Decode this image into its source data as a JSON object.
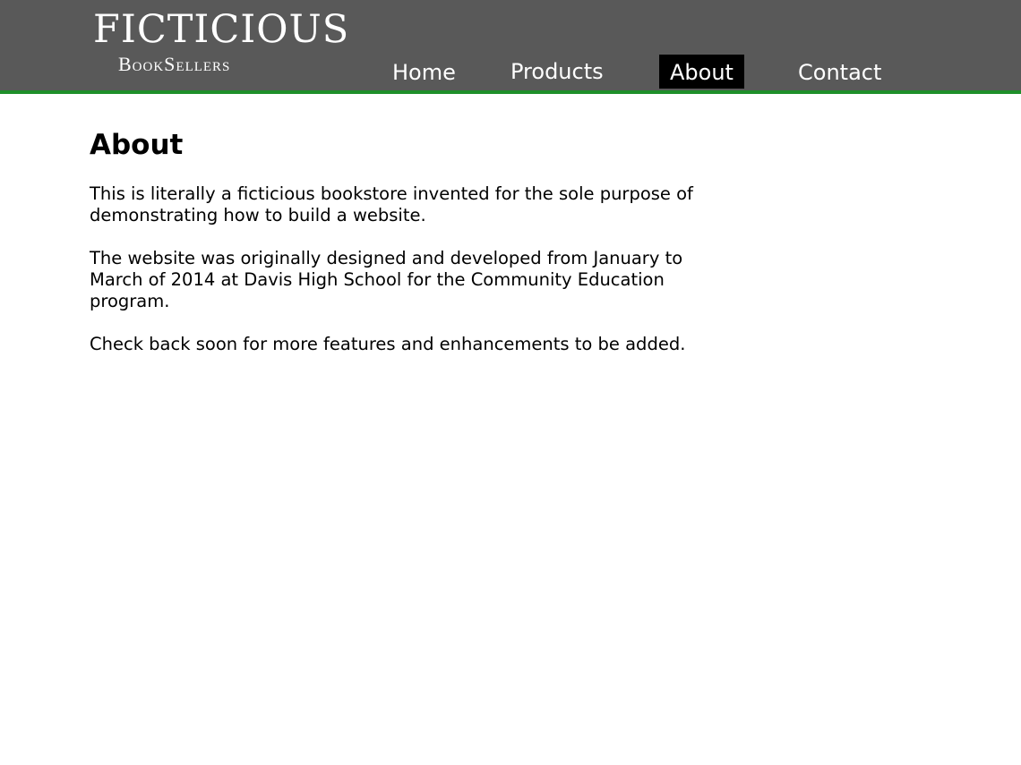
{
  "logo": {
    "line1": "FICTICIOUS",
    "line2": "BookSellers"
  },
  "nav": {
    "items": [
      {
        "label": "Home",
        "active": false
      },
      {
        "label": "Products",
        "active": false
      },
      {
        "label": "About",
        "active": true
      },
      {
        "label": "Contact",
        "active": false
      }
    ]
  },
  "page": {
    "title": "About",
    "paragraphs": [
      "This is literally a ficticious bookstore invented for the sole purpose of demonstrating how to build a website.",
      "The website was originally designed and developed from January to March of 2014 at Davis High School for the Community Education program.",
      "Check back soon for more features and enhancements to be added."
    ]
  },
  "colors": {
    "header_bg": "#595959",
    "header_border": "#1e8f2a",
    "nav_active_bg": "#000000",
    "text": "#000000",
    "nav_text": "#ffffff"
  }
}
